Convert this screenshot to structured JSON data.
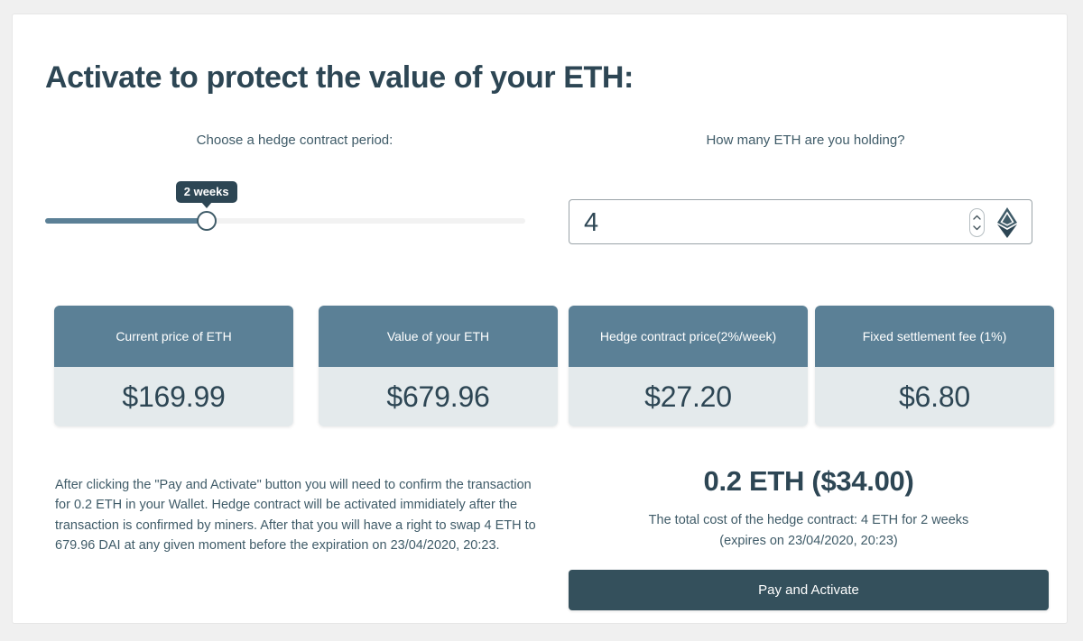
{
  "heading": "Activate to protect the value of your ETH:",
  "period_field": {
    "label": "Choose a hedge contract period:",
    "tooltip_value": "2 weeks",
    "fill_percent": 33.6
  },
  "amount_field": {
    "label": "How many ETH are you holding?",
    "value": "4",
    "spinner_icon": "number-spinner-icon",
    "currency_icon": "ethereum-logo-icon"
  },
  "cards": [
    {
      "title": "Current price of ETH",
      "value": "$169.99"
    },
    {
      "title": "Value of your ETH",
      "value": "$679.96"
    },
    {
      "title": "Hedge contract price(2%/week)",
      "value": "$27.20"
    },
    {
      "title": "Fixed settlement fee (1%)",
      "value": "$6.80"
    }
  ],
  "note": "After clicking the \"Pay and Activate\" button you will need to confirm the transaction for 0.2 ETH in your Wallet. Hedge contract will be activated immidiately after the transaction is confirmed by miners. After that you will have a right to swap 4 ETH to 679.96 DAI at any given moment before the expiration on 23/04/2020, 20:23.",
  "summary": {
    "total": "0.2 ETH ($34.00)",
    "detail_line_1": "The total cost of the hedge contract: 4 ETH for 2 weeks",
    "detail_line_2": "(expires on 23/04/2020, 20:23)",
    "action_label": "Pay and Activate"
  },
  "colors": {
    "page_background": "#f0f0f0",
    "panel_background": "#ffffff",
    "heading_text": "#2d4654",
    "body_text": "#3f5b68",
    "card_header": "#5b8096",
    "card_body": "#e4eaec",
    "button": "#34505c",
    "track": "#f2f2f2"
  }
}
